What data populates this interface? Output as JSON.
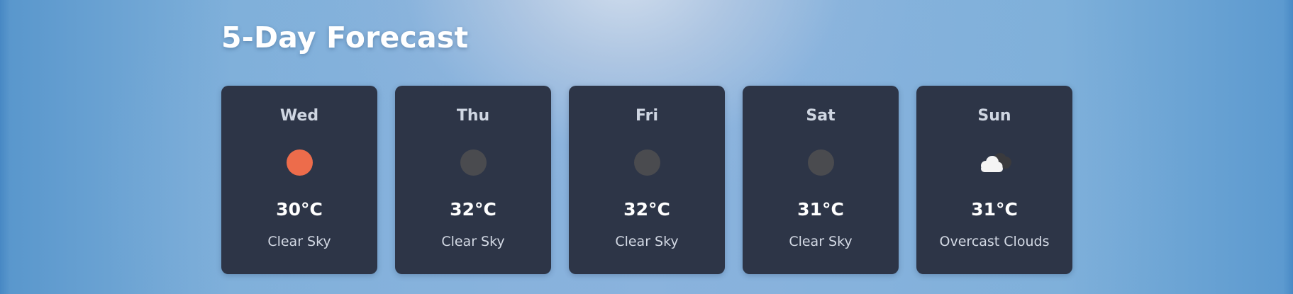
{
  "forecast": {
    "title": "5-Day Forecast",
    "days": [
      {
        "day": "Wed",
        "icon": "sun-icon",
        "icon_color": "#ed6c4b",
        "temp": "30°C",
        "description": "Clear Sky"
      },
      {
        "day": "Thu",
        "icon": "moon-icon",
        "icon_color": "#4a4b4f",
        "temp": "32°C",
        "description": "Clear Sky"
      },
      {
        "day": "Fri",
        "icon": "moon-icon",
        "icon_color": "#4a4b4f",
        "temp": "32°C",
        "description": "Clear Sky"
      },
      {
        "day": "Sat",
        "icon": "moon-icon",
        "icon_color": "#4a4b4f",
        "temp": "31°C",
        "description": "Clear Sky"
      },
      {
        "day": "Sun",
        "icon": "overcast-clouds-icon",
        "icon_color": "#f5f5f5",
        "temp": "31°C",
        "description": "Overcast Clouds"
      }
    ]
  },
  "colors": {
    "card_background": "#2d3547",
    "title_text": "#ffffff"
  }
}
